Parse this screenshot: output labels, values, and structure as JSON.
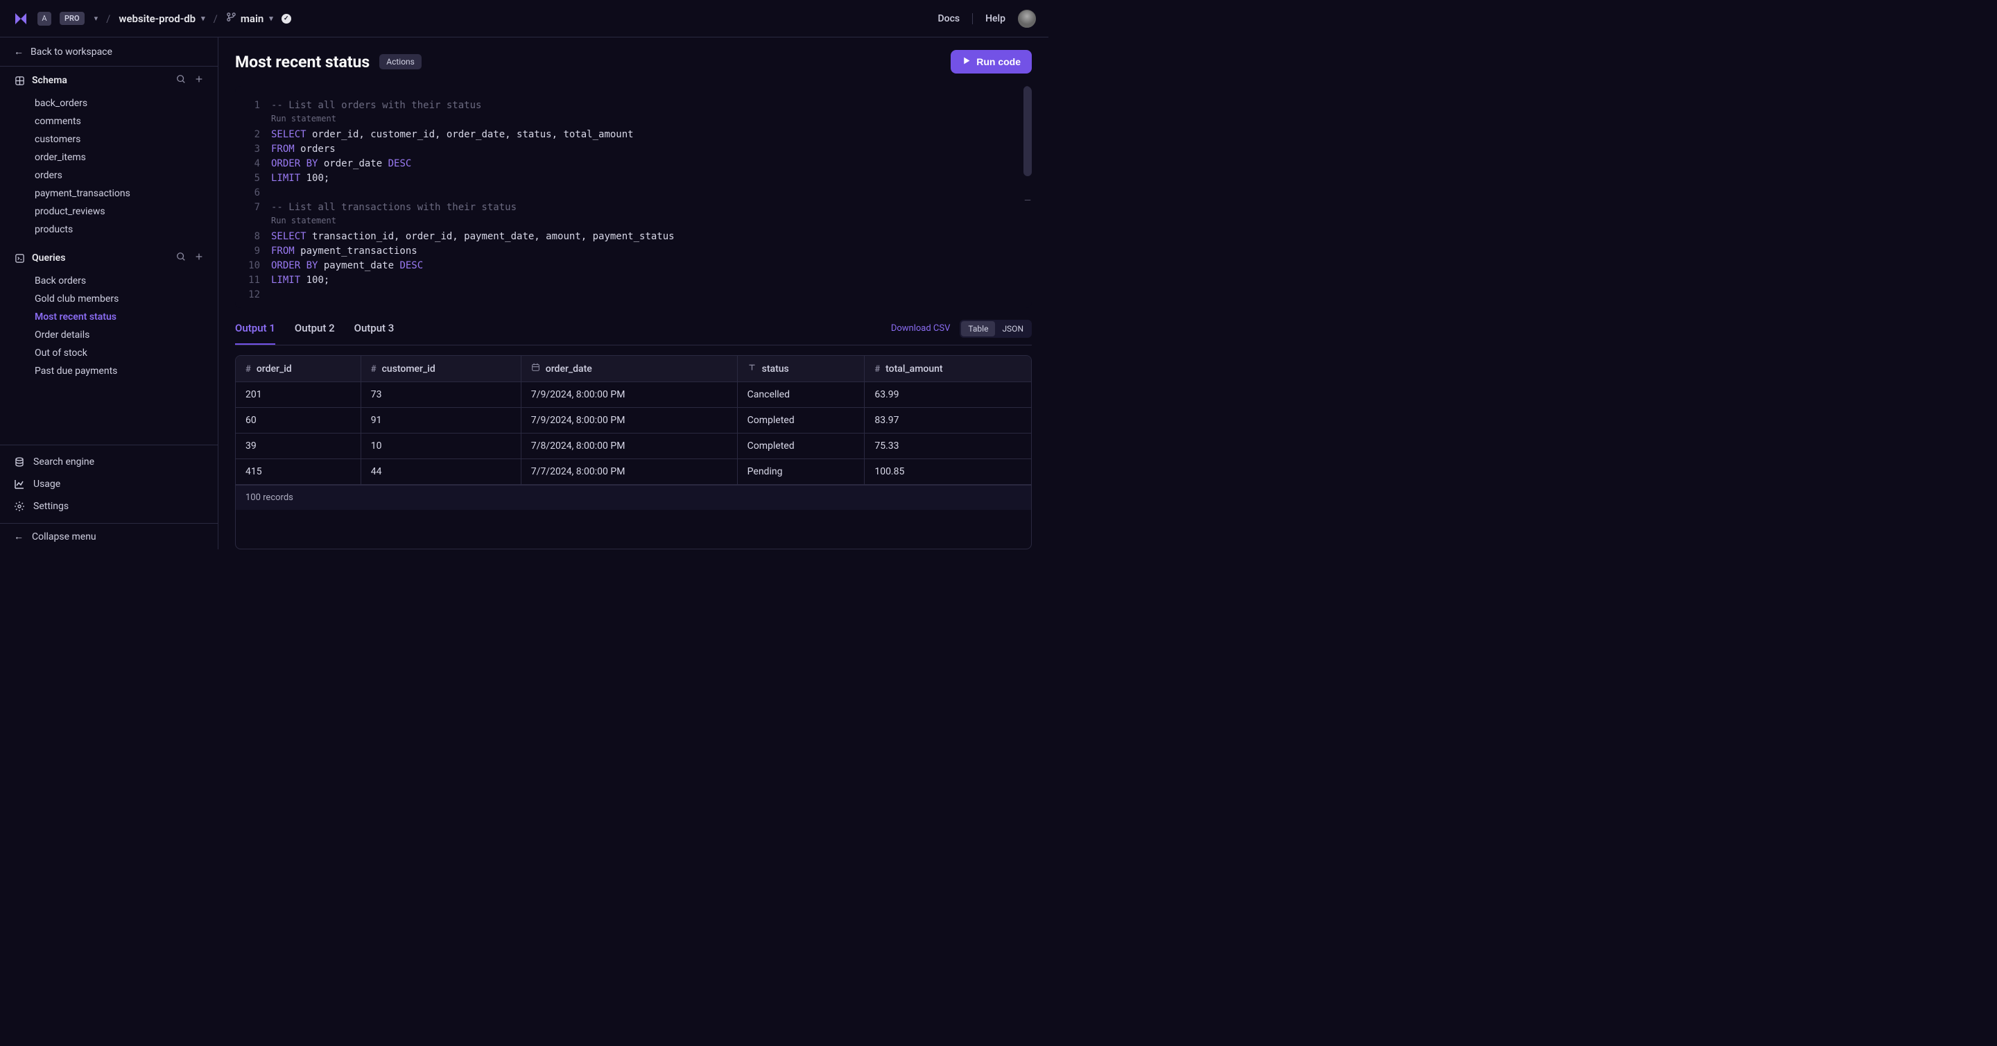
{
  "topbar": {
    "workspace_letter": "A",
    "pro_badge": "PRO",
    "project_name": "website-prod-db",
    "branch_name": "main",
    "docs": "Docs",
    "help": "Help"
  },
  "sidebar": {
    "back_label": "Back to workspace",
    "schema_header": "Schema",
    "schema_items": [
      "back_orders",
      "comments",
      "customers",
      "order_items",
      "orders",
      "payment_transactions",
      "product_reviews",
      "products"
    ],
    "queries_header": "Queries",
    "query_items": [
      "Back orders",
      "Gold club members",
      "Most recent status",
      "Order details",
      "Out of stock",
      "Past due payments"
    ],
    "active_query_index": 2,
    "bottom_items": [
      "Search engine",
      "Usage",
      "Settings"
    ],
    "collapse_label": "Collapse menu"
  },
  "content": {
    "title": "Most recent status",
    "actions_label": "Actions",
    "run_label": "Run code"
  },
  "editor": {
    "run_stmt_label": "Run statement",
    "lines": [
      {
        "n": 1,
        "tokens": [
          {
            "t": "-- List all orders with their status",
            "c": "comment"
          }
        ],
        "run_after": true
      },
      {
        "n": 2,
        "tokens": [
          {
            "t": "SELECT",
            "c": "keyword"
          },
          {
            "t": " order_id, customer_id, order_date, status, total_amount",
            "c": "ident"
          }
        ]
      },
      {
        "n": 3,
        "tokens": [
          {
            "t": "FROM",
            "c": "keyword"
          },
          {
            "t": " orders",
            "c": "ident"
          }
        ]
      },
      {
        "n": 4,
        "tokens": [
          {
            "t": "ORDER BY",
            "c": "keyword"
          },
          {
            "t": " order_date ",
            "c": "ident"
          },
          {
            "t": "DESC",
            "c": "keyword"
          }
        ]
      },
      {
        "n": 5,
        "tokens": [
          {
            "t": "LIMIT",
            "c": "keyword"
          },
          {
            "t": " 100;",
            "c": "num"
          }
        ]
      },
      {
        "n": 6,
        "tokens": []
      },
      {
        "n": 7,
        "tokens": [
          {
            "t": "-- List all transactions with their status",
            "c": "comment"
          }
        ],
        "run_after": true
      },
      {
        "n": 8,
        "tokens": [
          {
            "t": "SELECT",
            "c": "keyword"
          },
          {
            "t": " transaction_id, order_id, payment_date, amount, payment_status",
            "c": "ident"
          }
        ]
      },
      {
        "n": 9,
        "tokens": [
          {
            "t": "FROM",
            "c": "keyword"
          },
          {
            "t": " payment_transactions",
            "c": "ident"
          }
        ]
      },
      {
        "n": 10,
        "tokens": [
          {
            "t": "ORDER BY",
            "c": "keyword"
          },
          {
            "t": " payment_date ",
            "c": "ident"
          },
          {
            "t": "DESC",
            "c": "keyword"
          }
        ]
      },
      {
        "n": 11,
        "tokens": [
          {
            "t": "LIMIT",
            "c": "keyword"
          },
          {
            "t": " 100;",
            "c": "num"
          }
        ]
      },
      {
        "n": 12,
        "tokens": []
      }
    ]
  },
  "output": {
    "tabs": [
      "Output 1",
      "Output 2",
      "Output 3"
    ],
    "active_tab": 0,
    "download_label": "Download CSV",
    "view_table": "Table",
    "view_json": "JSON",
    "columns": [
      {
        "name": "order_id",
        "icon": "#"
      },
      {
        "name": "customer_id",
        "icon": "#"
      },
      {
        "name": "order_date",
        "icon": "date"
      },
      {
        "name": "status",
        "icon": "T"
      },
      {
        "name": "total_amount",
        "icon": "#"
      }
    ],
    "rows": [
      [
        "201",
        "73",
        "7/9/2024, 8:00:00 PM",
        "Cancelled",
        "63.99"
      ],
      [
        "60",
        "91",
        "7/9/2024, 8:00:00 PM",
        "Completed",
        "83.97"
      ],
      [
        "39",
        "10",
        "7/8/2024, 8:00:00 PM",
        "Completed",
        "75.33"
      ],
      [
        "415",
        "44",
        "7/7/2024, 8:00:00 PM",
        "Pending",
        "100.85"
      ]
    ],
    "footer": "100 records"
  }
}
